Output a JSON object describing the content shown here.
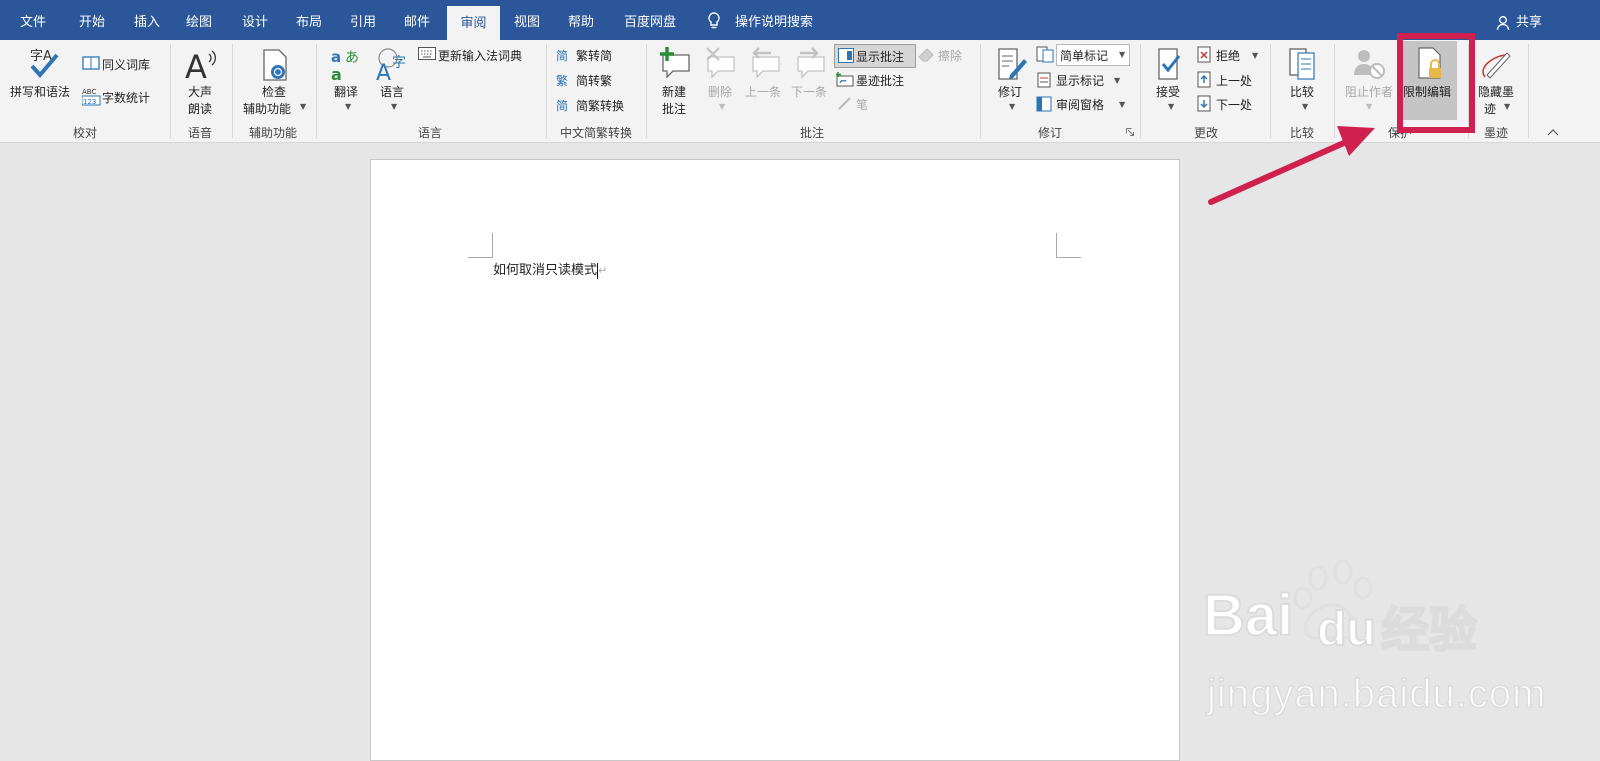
{
  "tabs": [
    "文件",
    "开始",
    "插入",
    "绘图",
    "设计",
    "布局",
    "引用",
    "邮件",
    "审阅",
    "视图",
    "帮助",
    "百度网盘"
  ],
  "active_tab": "审阅",
  "tell_me": "操作说明搜索",
  "share": "共享",
  "ribbon": {
    "proofing": {
      "spelling": "拼写和语法",
      "thesaurus": "同义词库",
      "word_count": "字数统计",
      "group": "校对"
    },
    "speech": {
      "read_aloud_1": "大声",
      "read_aloud_2": "朗读",
      "group": "语音"
    },
    "accessibility": {
      "check_1": "检查",
      "check_2": "辅助功能",
      "group": "辅助功能"
    },
    "language": {
      "translate": "翻译",
      "language": "语言",
      "update_ime": "更新输入法词典",
      "group": "语言"
    },
    "chinese_conv": {
      "to_simplified": "繁转简",
      "to_traditional": "简转繁",
      "conversion": "简繁转换",
      "group": "中文简繁转换"
    },
    "comments": {
      "new_1": "新建",
      "new_2": "批注",
      "delete": "删除",
      "prev": "上一条",
      "next": "下一条",
      "show": "显示批注",
      "erase": "擦除",
      "ink": "墨迹批注",
      "pen": "笔",
      "group": "批注"
    },
    "tracking": {
      "track": "修订",
      "markup_select": "简单标记",
      "show_markup": "显示标记",
      "review_pane": "审阅窗格",
      "group": "修订"
    },
    "changes": {
      "accept": "接受",
      "reject": "拒绝",
      "previous": "上一处",
      "next": "下一处",
      "group": "更改"
    },
    "compare": {
      "compare": "比较",
      "group": "比较"
    },
    "protect": {
      "block_authors": "阻止作者",
      "restrict_editing": "限制编辑",
      "group": "保护"
    },
    "ink": {
      "hide_1": "隐藏墨",
      "hide_2": "迹",
      "group": "墨迹"
    }
  },
  "document": {
    "text": "如何取消只读模式"
  },
  "watermark": {
    "brand": "Bai",
    "brand2": "du",
    "cn": "经验",
    "url": "jingyan.baidu.com"
  },
  "colors": {
    "tabbar": "#2b579a",
    "highlight": "#d0204f"
  }
}
